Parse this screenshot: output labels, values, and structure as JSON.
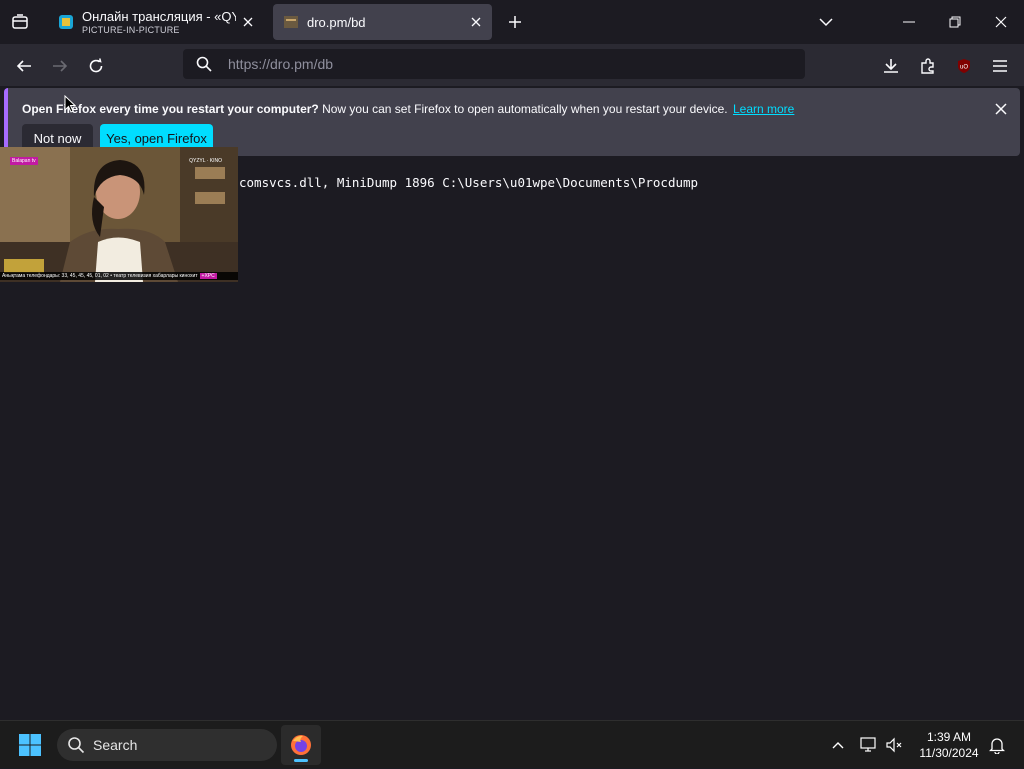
{
  "browser": {
    "tabs": [
      {
        "title": "Онлайн трансляция - «QYZYL",
        "subtitle": "PICTURE-IN-PICTURE",
        "active": false
      },
      {
        "title": "dro.pm/bd",
        "active": true
      }
    ],
    "url": "https://dro.pm/db",
    "url_placeholder": ""
  },
  "notification": {
    "bold": "Open Firefox every time you restart your computer?",
    "text": "Now you can set Firefox to open automatically when you restart your device.",
    "link": "Learn more",
    "not_now": "Not now",
    "yes": "Yes, open Firefox"
  },
  "page": {
    "command_text": "comsvcs.dll, MiniDump 1896 C:\\Users\\u01wpe\\Documents\\Procdump"
  },
  "pip": {
    "channel_left": "Balapan tv",
    "channel_right": "QYZYL · KINO",
    "ticker_text": "Анықтама телефондары: 33, 45, 45, 45, 01, 02 • театр телевизия хабарлары кинохит",
    "ticker_label": "+XPC"
  },
  "taskbar": {
    "search_label": "Search",
    "time": "1:39 AM",
    "date": "11/30/2024"
  },
  "colors": {
    "accent": "#00ddff",
    "notification_bar": "#a66bff",
    "tab_active": "#42414d",
    "background": "#1c1b22"
  },
  "icons": [
    "tab-overview-icon",
    "close-icon",
    "plus-icon",
    "chevron-down-icon",
    "minimize-icon",
    "restore-icon",
    "back-icon",
    "forward-icon",
    "reload-icon",
    "search-icon",
    "download-icon",
    "extensions-icon",
    "ublock-icon",
    "hamburger-menu-icon",
    "windows-start-icon",
    "firefox-icon",
    "chevron-up-icon",
    "network-icon",
    "volume-muted-icon",
    "bell-icon"
  ]
}
